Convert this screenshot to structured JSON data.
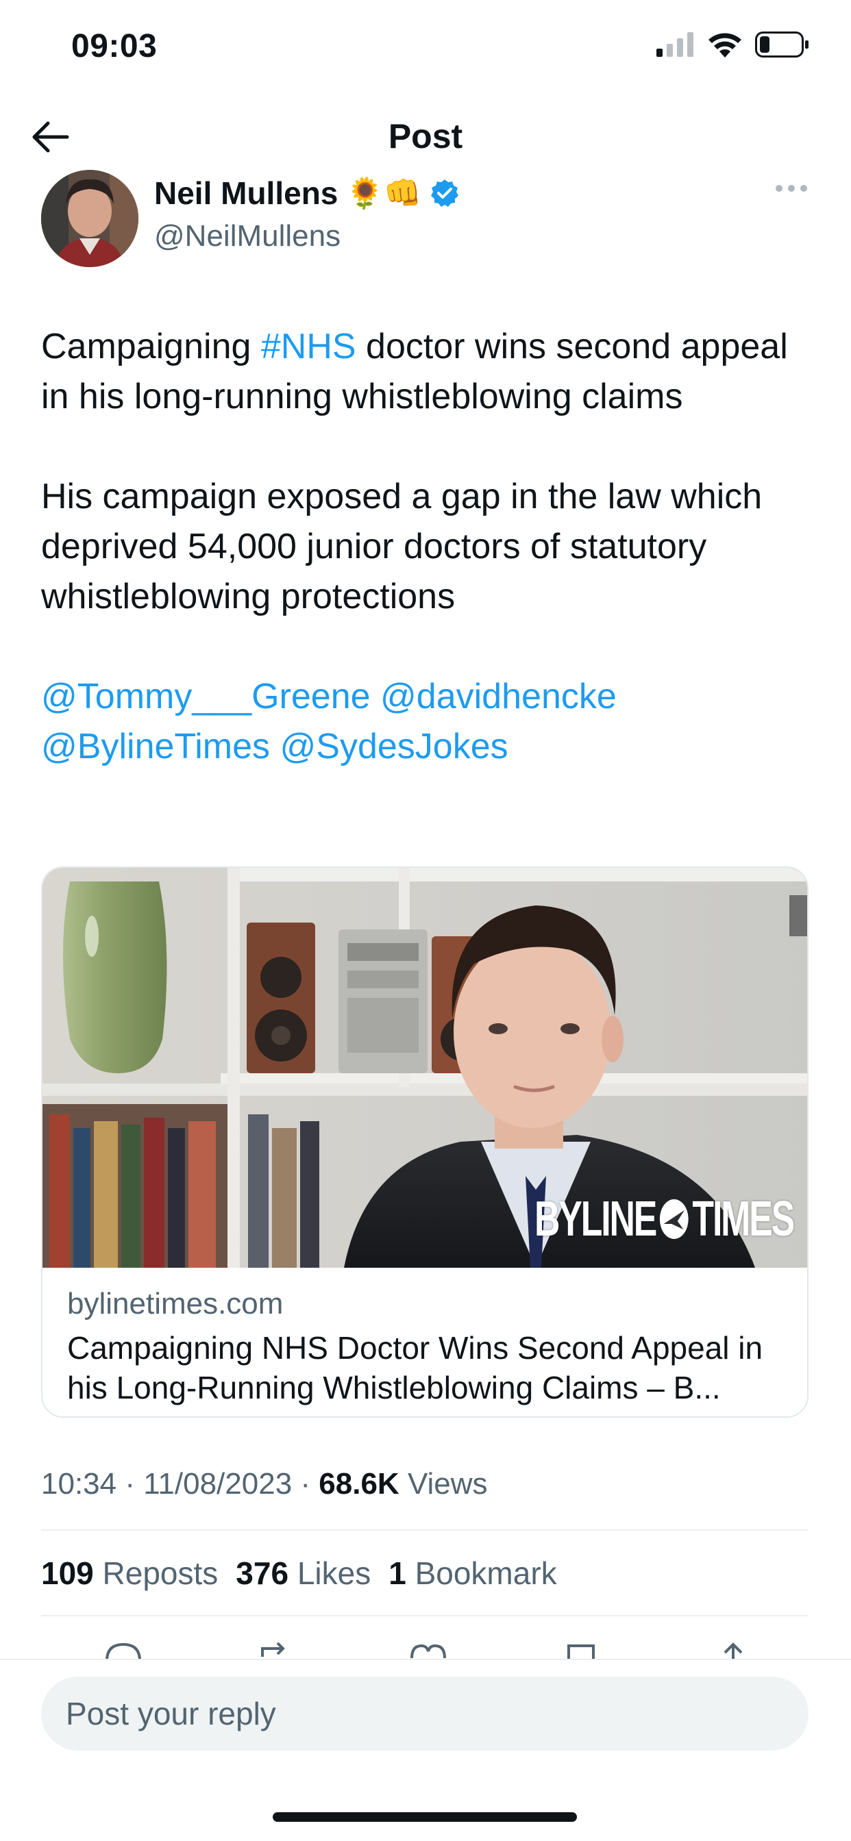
{
  "status_bar": {
    "time": "09:03"
  },
  "header": {
    "title": "Post"
  },
  "author": {
    "name": "Neil Mullens",
    "emojis": "🌻👊",
    "handle": "@NeilMullens"
  },
  "tweet": {
    "para1": {
      "prefix": "Campaigning ",
      "hashtag": "#NHS",
      "suffix": " doctor wins second appeal in his long-running whistleblowing claims"
    },
    "para2": "His campaign exposed a gap in the law which deprived 54,000 junior doctors of statutory whistleblowing protections",
    "mentions": [
      "@Tommy___Greene",
      "@davidhencke",
      "@BylineTimes",
      "@SydesJokes"
    ]
  },
  "card": {
    "watermark_part1": "BYLINE",
    "watermark_part2": "TIMES",
    "domain": "bylinetimes.com",
    "title": "Campaigning NHS Doctor Wins Second Appeal in his Long-Running Whistleblowing Claims – B..."
  },
  "meta": {
    "time": "10:34",
    "date": "11/08/2023",
    "views_count": "68.6K",
    "views_label": "Views",
    "separator": " · "
  },
  "stats": {
    "reposts_count": "109",
    "reposts_label": "Reposts",
    "likes_count": "376",
    "likes_label": "Likes",
    "bookmarks_count": "1",
    "bookmarks_label": "Bookmark"
  },
  "reply": {
    "placeholder": "Post your reply"
  },
  "colors": {
    "link": "#1d9bf0",
    "secondary_text": "#536471",
    "verified": "#1d9bf0"
  }
}
